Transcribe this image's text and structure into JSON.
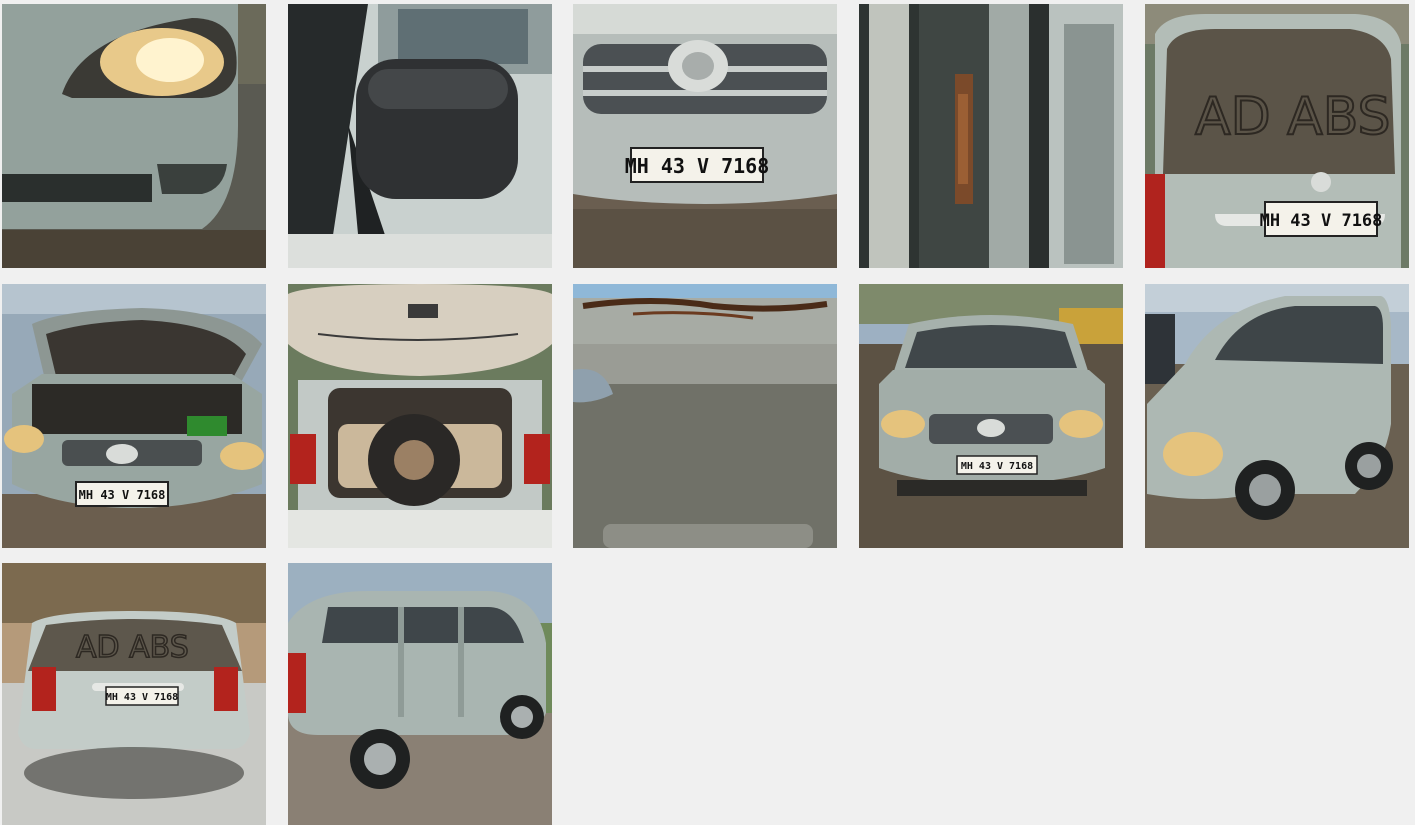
{
  "plate": "MH 43 V 7168",
  "window_scrawl": "AD ABS",
  "photos": [
    {
      "name": "photo-front-left-headlight",
      "icon": "headlight-closeup"
    },
    {
      "name": "photo-side-mirror",
      "icon": "side-mirror-closeup"
    },
    {
      "name": "photo-front-grille",
      "icon": "front-grille-plate"
    },
    {
      "name": "photo-door-pillar-rust",
      "icon": "rust-pillar-closeup"
    },
    {
      "name": "photo-rear-window-dust",
      "icon": "rear-window-closeup"
    },
    {
      "name": "photo-engine-bay",
      "icon": "open-hood"
    },
    {
      "name": "photo-open-trunk",
      "icon": "open-trunk"
    },
    {
      "name": "photo-roof-rust",
      "icon": "roof-rust-closeup"
    },
    {
      "name": "photo-front-view",
      "icon": "car-front"
    },
    {
      "name": "photo-front-three-quarter",
      "icon": "car-three-quarter"
    },
    {
      "name": "photo-rear-view",
      "icon": "car-rear"
    },
    {
      "name": "photo-side-view",
      "icon": "car-side"
    }
  ],
  "colors": {
    "background": "#f0f0f0",
    "car_body": "#aab4ae",
    "plate": "#f4f2ea",
    "ground": "#6e6558"
  }
}
